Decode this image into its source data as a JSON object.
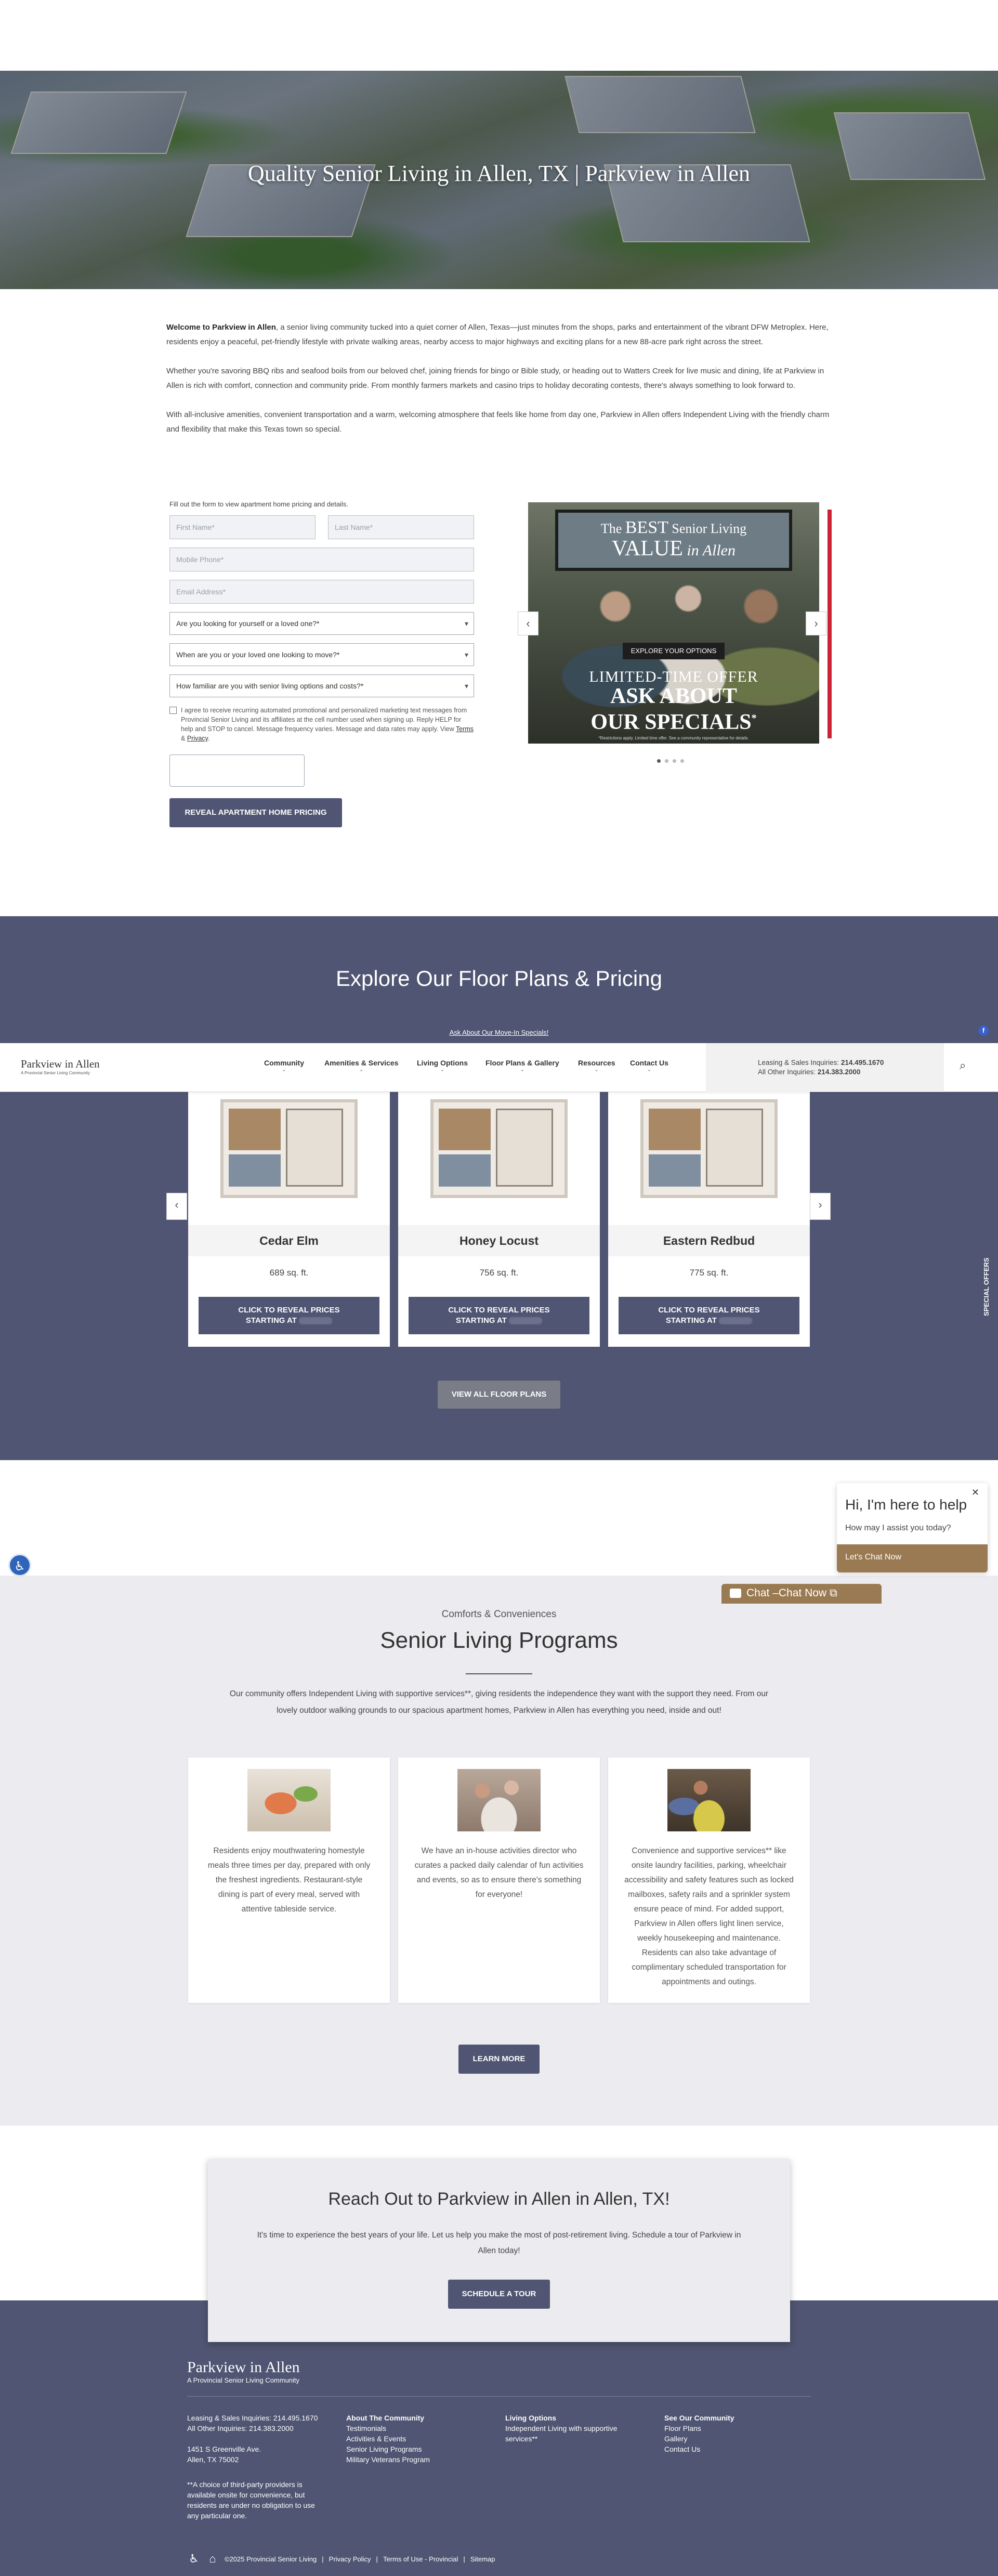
{
  "hero": {
    "title": "Quality Senior Living in Allen, TX | Parkview in Allen"
  },
  "intro": {
    "p1_bold": "Welcome to Parkview in Allen",
    "p1_rest": ", a senior living community tucked into a quiet corner of Allen, Texas—just minutes from the shops, parks and entertainment of the vibrant DFW Metroplex. Here, residents enjoy a peaceful, pet-friendly lifestyle with private walking areas, nearby access to major highways and exciting plans for a new 88-acre park right across the street.",
    "p2": "Whether you're savoring BBQ ribs and seafood boils from our beloved chef, joining friends for bingo or Bible study, or heading out to Watters Creek for live music and dining, life at Parkview in Allen is rich with comfort, connection and community pride. From monthly farmers markets and casino trips to holiday decorating contests, there's always something to look forward to.",
    "p3": "With all-inclusive amenities, convenient transportation and a warm, welcoming atmosphere that feels like home from day one, Parkview in Allen offers Independent Living with the friendly charm and flexibility that make this Texas town so special."
  },
  "form": {
    "intro": "Fill out the form to view apartment home pricing and details.",
    "first_name": "First Name*",
    "last_name": "Last Name*",
    "mobile": "Mobile Phone*",
    "email": "Email Address*",
    "select1": "Are you looking for yourself or a loved one?*",
    "select2": "When are you or your loved one looking to move?*",
    "select3": "How familiar are you with senior living options and costs?*",
    "consent_text": "I agree to receive recurring automated promotional and personalized marketing text messages from Provincial Senior Living and its affiliates at the cell number used when signing up. Reply HELP for help and STOP to cancel. Message frequency varies. Message and data rates may apply. View ",
    "terms": "Terms",
    "amp": " & ",
    "privacy": "Privacy",
    "period": ".",
    "submit": "REVEAL APARTMENT HOME PRICING"
  },
  "promo": {
    "line1a": "The ",
    "line1b": "BEST",
    "line1c": " Senior Living",
    "line2a": "VALUE",
    "line2b": " in Allen",
    "explore": "EXPLORE YOUR OPTIONS",
    "lto1": "LIMITED-TIME OFFER",
    "lto2": "ASK ABOUT",
    "lto3": "OUR SPECIALS",
    "lto_star": "*",
    "fine": "*Restrictions apply. Limited time offer. See a community representative for details.",
    "prev": "‹",
    "next": "›"
  },
  "floorplans": {
    "title": "Explore Our Floor Plans & Pricing",
    "movein_link": "Ask About Our Move-In Specials!",
    "plans": [
      {
        "name": "Cedar Elm",
        "sqft": "689 sq. ft.",
        "cta1": "CLICK TO REVEAL PRICES",
        "cta2": "STARTING AT"
      },
      {
        "name": "Honey Locust",
        "sqft": "756 sq. ft.",
        "cta1": "CLICK TO REVEAL PRICES",
        "cta2": "STARTING AT"
      },
      {
        "name": "Eastern Redbud",
        "sqft": "775 sq. ft.",
        "cta1": "CLICK TO REVEAL PRICES",
        "cta2": "STARTING AT"
      }
    ],
    "view_all": "VIEW ALL FLOOR PLANS",
    "prev": "‹",
    "next": "›"
  },
  "nav": {
    "logo": "Parkview in Allen",
    "logo_sub": "A Provincial Senior Living Community",
    "items": [
      "Community",
      "Amenities & Services",
      "Living Options",
      "Floor Plans & Gallery",
      "Resources",
      "Contact Us"
    ],
    "leasing_label": "Leasing & Sales Inquiries: ",
    "leasing_phone": "214.495.1670",
    "other_label": "All Other Inquiries: ",
    "other_phone": "214.383.2000",
    "search_icon": "⌕"
  },
  "side": {
    "special_offers": "SPECIAL OFFERS",
    "facebook": "f"
  },
  "chat": {
    "close": "✕",
    "heading": "Hi, I'm here to help",
    "sub": "How may I assist you today?",
    "button": "Let's Chat Now",
    "tab_label": "Chat",
    "tab_label2": "Chat Now"
  },
  "programs": {
    "eyebrow": "Comforts & Conveniences",
    "title": "Senior Living Programs",
    "desc": "Our community offers Independent Living with supportive services**, giving residents the independence they want with the support they need. From our lovely outdoor walking grounds to our spacious apartment homes, Parkview in Allen has everything you need, inside and out!",
    "cards": [
      "Residents enjoy mouthwatering homestyle meals three times per day, prepared with only the freshest ingredients. Restaurant-style dining is part of every meal, served with attentive tableside service.",
      "We have an in-house activities director who curates a packed daily calendar of fun activities and events, so as to ensure there's something for everyone!",
      "Convenience and supportive services** like onsite laundry facilities, parking, wheelchair accessibility and safety features such as locked mailboxes, safety rails and a sprinkler system ensure peace of mind. For added support, Parkview in Allen offers light linen service, weekly housekeeping and maintenance. Residents can also take advantage of complimentary scheduled transportation for appointments and outings."
    ],
    "learn_more": "LEARN MORE"
  },
  "reach": {
    "title": "Reach Out to Parkview in Allen in Allen, TX!",
    "text": "It's time to experience the best years of your life. Let us help you make the most of post-retirement living. Schedule a tour of Parkview in Allen today!",
    "button": "SCHEDULE A TOUR"
  },
  "footer": {
    "logo": "Parkview in Allen",
    "logo_sub": "A Provincial Senior Living Community",
    "leasing": "Leasing & Sales Inquiries: 214.495.1670",
    "other": "All Other Inquiries: 214.383.2000",
    "addr1": "1451 S Greenville Ave.",
    "addr2": "Allen, TX 75002",
    "disclaimer": "**A choice of third-party providers is available onsite for convenience, but residents are under no obligation to use any particular one.",
    "about_h": "About The Community",
    "about": [
      "Testimonials",
      "Activities & Events",
      "Senior Living Programs",
      "Military Veterans Program"
    ],
    "living_h": "Living Options",
    "living": [
      "Independent Living with supportive",
      "services**"
    ],
    "see_h": "See Our Community",
    "see": [
      "Floor Plans",
      "Gallery",
      "Contact Us"
    ],
    "copyright": "©2025 Provincial Senior Living",
    "privacy": "Privacy Policy",
    "terms": "Terms of Use - Provincial",
    "sitemap": "Sitemap",
    "sep": "|"
  }
}
